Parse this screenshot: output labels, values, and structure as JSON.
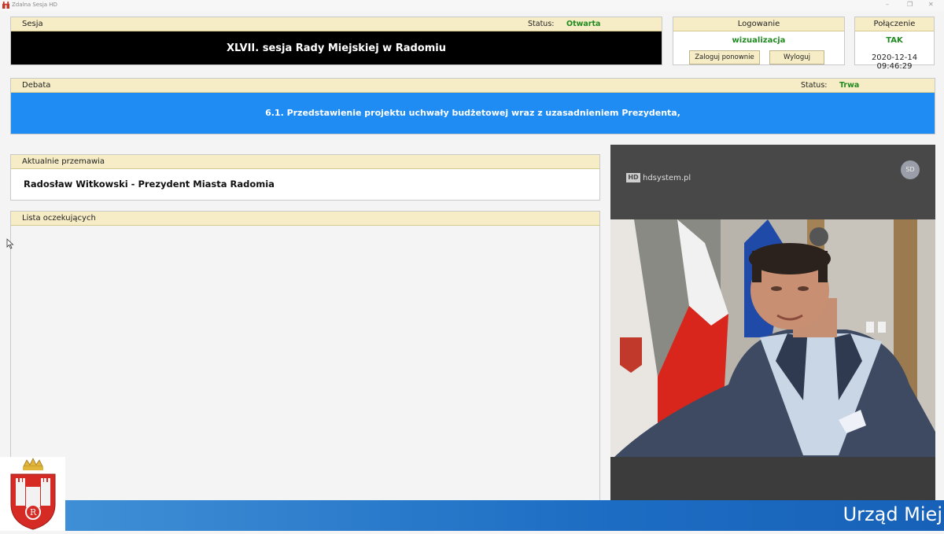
{
  "window": {
    "title": "Zdalna Sesja HD"
  },
  "session": {
    "header_label": "Sesja",
    "status_label": "Status:",
    "status_value": "Otwarta",
    "title": "XLVII. sesja Rady Miejskiej w Radomiu"
  },
  "login": {
    "header_label": "Logowanie",
    "user": "wizualizacja",
    "relogin_label": "Zaloguj ponownie",
    "logout_label": "Wyloguj"
  },
  "connection": {
    "header_label": "Połączenie",
    "value": "TAK",
    "datetime": "2020-12-14 09:46:29"
  },
  "debate": {
    "header_label": "Debata",
    "status_label": "Status:",
    "status_value": "Trwa",
    "topic": "6.1. Przedstawienie projektu uchwały budżetowej wraz z uzasadnieniem Prezydenta,"
  },
  "current_speaker": {
    "header_label": "Aktualnie przemawia",
    "name": "Radosław Witkowski - Prezydent Miasta Radomia"
  },
  "waiting_list": {
    "header_label": "Lista oczekujących",
    "items": []
  },
  "video": {
    "brand": "hdsystem.pl",
    "brand_mark": "HD",
    "avatar_initials": "SD"
  },
  "footer": {
    "text": "Urząd Miej"
  },
  "colors": {
    "header_bg": "#f6ecc6",
    "status_green": "#1f8a1f",
    "debate_blue": "#1e8cf2",
    "session_black": "#000000",
    "footer_blue": "#1d6dc4"
  }
}
